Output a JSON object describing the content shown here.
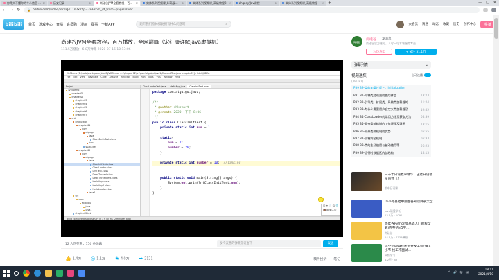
{
  "browser": {
    "tabs": [
      {
        "title": "你得大不懂你的个人信息 - 哔哩哔哩",
        "active": false
      },
      {
        "title": "历史记录",
        "active": false
      },
      {
        "title": "尚硅谷JVM全套教程，百万播放",
        "active": true
      },
      {
        "title": "实体系列视频课_bi高级教程_3",
        "active": false
      },
      {
        "title": "实体系列视频课_高级教程3",
        "active": false
      },
      {
        "title": "zhipley/Jav课程",
        "active": false
      },
      {
        "title": "实体系列视频课_高级教程",
        "active": false
      }
    ],
    "new_tab": "+",
    "window_controls": {
      "minimize": "—",
      "maximize": "□",
      "close": "✕"
    },
    "url": "bilibili.com/video/BV1PJ411n7xZ?p=39&spm_id_from=pageDriver",
    "nav": {
      "back": "←",
      "forward": "→",
      "reload": "↻"
    }
  },
  "site": {
    "logo": "bilibili",
    "nav_links": [
      "首页",
      "游戏中心",
      "直播",
      "会员购",
      "漫画",
      "赛事",
      "下载APP"
    ],
    "search_placeholder": "跑开我们身体如此拥有什么问题呀",
    "search_icon": "search-icon",
    "user_links": [
      "大会员",
      "消息",
      "动态",
      "收藏",
      "历史",
      "创作中心"
    ],
    "post_button": "投稿"
  },
  "video": {
    "title": "尚硅谷JVM全套教程，百万播放，全网巅峰（宋红康详解java虚拟机）",
    "meta": "111.5万播放 · 6.8万弹幕    2020-07-16 10:13:06"
  },
  "uploader": {
    "avatar_text": "尚硅谷",
    "name": "尚硅谷",
    "message": "发消息",
    "desc": "尚硅谷官方账号，人尽一尽本领服务专业",
    "charge_label": "为TA充电",
    "follow_label": "+ 关注 31.1万"
  },
  "ide": {
    "title": "JVMDemo [D:\\code\\workspace_idea5\\JVMDemo] - ...\\chapter02\\src\\com\\atguigu\\java1\\ClassInitTest.java [chapter02] - IntelliJ IDEA",
    "menu": [
      "File",
      "Edit",
      "View",
      "Navigate",
      "Code",
      "Analyze",
      "Refactor",
      "Build",
      "Run",
      "Tools",
      "VCS",
      "Window",
      "Help"
    ],
    "project_header": "Project",
    "tree": [
      {
        "label": "JVMDemo",
        "type": "f",
        "indent": 0
      },
      {
        "label": "chapter01",
        "type": "f",
        "indent": 1
      },
      {
        "label": "chapter02",
        "type": "f",
        "indent": 1
      },
      {
        "label": "chapter03",
        "type": "f",
        "indent": 2
      },
      {
        "label": "chapter04",
        "type": "f",
        "indent": 2
      },
      {
        "label": "chapter05",
        "type": "f",
        "indent": 2
      },
      {
        "label": "chapter06",
        "type": "f",
        "indent": 2
      },
      {
        "label": "chapter07",
        "type": "f",
        "indent": 2
      },
      {
        "label": "out",
        "type": "b",
        "indent": 1
      },
      {
        "label": "production",
        "type": "b",
        "indent": 2
      },
      {
        "label": "chapter01",
        "type": "b",
        "indent": 3
      },
      {
        "label": "com",
        "type": "b",
        "indent": 4
      },
      {
        "label": "atguigu",
        "type": "b",
        "indent": 5
      },
      {
        "label": "java",
        "type": "b",
        "indent": 6
      },
      {
        "label": "StackDeOrTest.class",
        "type": "c",
        "indent": 7
      },
      {
        "label": "jvm",
        "type": "b",
        "indent": 6
      },
      {
        "label": "ss1to.def",
        "type": "c",
        "indent": 5
      },
      {
        "label": "chapter02",
        "type": "b",
        "indent": 3
      },
      {
        "label": "com",
        "type": "b",
        "indent": 4
      },
      {
        "label": "atguigu",
        "type": "b",
        "indent": 5
      },
      {
        "label": "java",
        "type": "b",
        "indent": 6
      },
      {
        "label": "ClassInitTest.class",
        "type": "c",
        "indent": 7,
        "selected": true
      },
      {
        "label": "ClassLoader.class",
        "type": "c",
        "indent": 7
      },
      {
        "label": "LinkTest.class",
        "type": "c",
        "indent": 7
      },
      {
        "label": "DeadThread.class",
        "type": "c",
        "indent": 7
      },
      {
        "label": "DeadThreadTest.class",
        "type": "c",
        "indent": 7
      },
      {
        "label": "HelloApp.class",
        "type": "c",
        "indent": 7
      },
      {
        "label": "HelloApp2.class",
        "type": "c",
        "indent": 7
      },
      {
        "label": "HelloLoader.class",
        "type": "c",
        "indent": 7
      },
      {
        "label": "java1",
        "type": "b",
        "indent": 6
      },
      {
        "label": "src",
        "type": "f",
        "indent": 2
      },
      {
        "label": "com",
        "type": "f",
        "indent": 3
      },
      {
        "label": "atguigu",
        "type": "f",
        "indent": 4
      },
      {
        "label": "java",
        "type": "f",
        "indent": 5
      },
      {
        "label": "java1",
        "type": "f",
        "indent": 5
      },
      {
        "label": "chapter02.iml",
        "type": "c",
        "indent": 2
      }
    ],
    "editor_tabs": [
      "ClassLoaderTest.java",
      "HelloApp.java",
      "ClassInitTest.java"
    ],
    "code_lines": [
      {
        "html": "<span class=\"kw\">package</span> com.atguigu.java;"
      },
      {
        "html": ""
      },
      {
        "html": "<span class=\"jd\">/**</span>"
      },
      {
        "html": "<span class=\"jd\"> * </span><span class=\"ann\">@author</span><span class=\"jd\"> shkstart</span>"
      },
      {
        "html": "<span class=\"jd\"> * </span><span class=\"ann\">@create</span><span class=\"jd\"> 2020  下午 8:06</span>"
      },
      {
        "html": "<span class=\"jd\"> */</span>"
      },
      {
        "html": "<span class=\"kw\">public class</span> ClassInitTest {"
      },
      {
        "html": "    <span class=\"kw\">private static int</span> <span class=\"fld\">num</span> = <span class=\"num\">1</span>;"
      },
      {
        "html": ""
      },
      {
        "html": "    <span class=\"kw\">static</span>{"
      },
      {
        "html": "        <span class=\"fld\">num</span> = <span class=\"num\">2</span>;"
      },
      {
        "html": "        <span class=\"fld\">number</span> = <span class=\"num\">20</span>;"
      },
      {
        "html": "    }"
      },
      {
        "html": ""
      },
      {
        "html": "    <span class=\"kw\">private static int</span> <span class=\"fld\">number</span> = <span class=\"num\">10</span>;  <span class=\"cm\">//linking</span>",
        "highlight": true
      },
      {
        "html": ""
      },
      {
        "html": ""
      },
      {
        "html": "    <span class=\"kw\">public static void</span> main(String[] args) {"
      },
      {
        "html": "        System.<span class=\"fld\">out</span>.println(ClassInitTest.<span class=\"fld\">num</span>);"
      },
      {
        "html": "    }"
      },
      {
        "html": "}"
      }
    ],
    "popup": [
      "中 ✦ 📄 ☺ 👕",
      "🐻 ⊞ 输入中"
    ],
    "status": "Build completed successfully in 3 s 40 ms (2 minutes ago)"
  },
  "danmaku": {
    "info": "12 人正在看，756 条弹幕",
    "placeholder": "发个友善的弹幕见证当下",
    "send": "发送"
  },
  "actions": {
    "like": "1.4万",
    "coin": "1.1万",
    "fav": "4.0万",
    "share": "2121",
    "right": [
      "稿件投诉",
      "笔记"
    ]
  },
  "sidebar": {
    "danmaku_list": "弹幕列表",
    "playlist_title": "视频选集",
    "playlist_count": "(39/381)",
    "autoplay": "自动连播",
    "items": [
      {
        "title": "P39  39-类的加载过程三：Initialization",
        "dur": "",
        "active": true
      },
      {
        "title": "P31  31-几种类加载器的使用体会",
        "dur": "13:23"
      },
      {
        "title": "P32  32-引导类、扩展类、系统类加载器的...",
        "dur": "11:24"
      },
      {
        "title": "P33  33-为什么需要用户自定义类加载器及...",
        "dur": "19:32"
      },
      {
        "title": "P34  34-ClassLoader的常用方法及获取方法",
        "dur": "05:39"
      },
      {
        "title": "P35  35-双亲委派机制的工作原理及演示",
        "dur": "13:15"
      },
      {
        "title": "P36  36-双亲委派机制的优势",
        "dur": "05:55"
      },
      {
        "title": "P37  37-沙箱安全机制",
        "dur": "06:33"
      },
      {
        "title": "P38  38-类的主动使用与被动使用等",
        "dur": "06:23"
      },
      {
        "title": "P39  39-运行时数据区内部结构",
        "dur": "15:13"
      }
    ]
  },
  "ad": {
    "title": "三十年日语教学精华，王者日语会员带你飞!",
    "sub": "前中日语课"
  },
  "recommend": [
    {
      "title": "Java零基础中期准备知识目录大全",
      "up": "Java磁爱学长",
      "stats": "23.6万 · 1091",
      "color": "#3a5cc4"
    },
    {
      "title": "尚硅谷Python零基础入门教程全套(完整的)自学...",
      "up": "尚硅谷",
      "stats": "24.4万 · 4734弹幕",
      "color": "#f3c445"
    },
    {
      "title": "玩不到java程序员开发工作?推文小节 找工作面试...",
      "up": "高频学习",
      "stats": "4.2万 · 83",
      "color": "#2b8a4a"
    }
  ],
  "taskbar": {
    "time": "18:11",
    "date": "2021/4/10",
    "tray": [
      "^",
      "🔊",
      "英",
      "拼"
    ]
  }
}
